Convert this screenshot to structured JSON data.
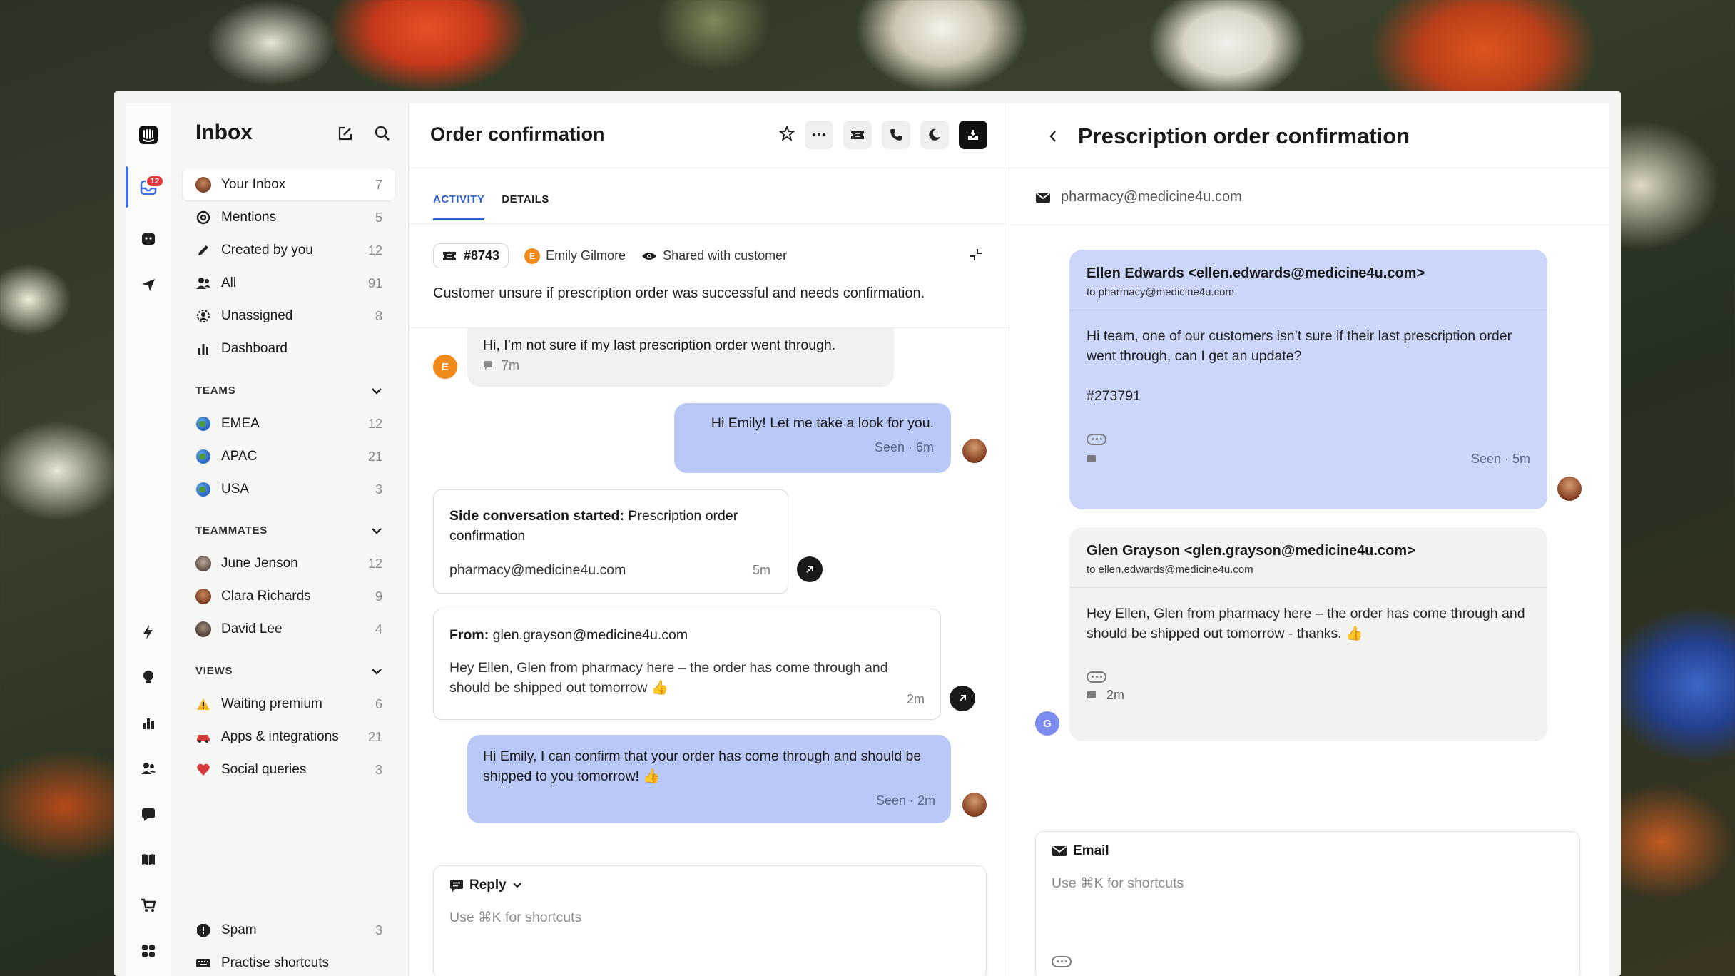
{
  "rail": {
    "badge_count": "12"
  },
  "sidebar": {
    "title": "Inbox",
    "items": [
      {
        "label": "Your Inbox",
        "count": "7"
      },
      {
        "label": "Mentions",
        "count": "5"
      },
      {
        "label": "Created by you",
        "count": "12"
      },
      {
        "label": "All",
        "count": "91"
      },
      {
        "label": "Unassigned",
        "count": "8"
      },
      {
        "label": "Dashboard",
        "count": ""
      }
    ],
    "teams_label": "TEAMS",
    "teams": [
      {
        "label": "EMEA",
        "count": "12"
      },
      {
        "label": "APAC",
        "count": "21"
      },
      {
        "label": "USA",
        "count": "3"
      }
    ],
    "teammates_label": "TEAMMATES",
    "teammates": [
      {
        "label": "June Jenson",
        "count": "12"
      },
      {
        "label": "Clara Richards",
        "count": "9"
      },
      {
        "label": "David Lee",
        "count": "4"
      }
    ],
    "views_label": "VIEWS",
    "views": [
      {
        "label": "Waiting premium",
        "count": "6"
      },
      {
        "label": "Apps & integrations",
        "count": "21"
      },
      {
        "label": "Social queries",
        "count": "3"
      }
    ],
    "bottom": [
      {
        "label": "Spam",
        "count": "3"
      },
      {
        "label": "Practise shortcuts",
        "count": ""
      }
    ]
  },
  "conversation": {
    "title": "Order confirmation",
    "tabs": [
      "ACTIVITY",
      "DETAILS"
    ],
    "ticket_id": "#8743",
    "customer_initial": "E",
    "customer": "Emily Gilmore",
    "shared": "Shared with customer",
    "summary": "Customer unsure if prescription order was successful and needs confirmation.",
    "msg1": {
      "text": "Hi, I’m not sure if my last prescription order went through.",
      "time": "7m",
      "initial": "E"
    },
    "msg2": {
      "text": "Hi Emily! Let me take a look for you.",
      "time": "Seen · 6m"
    },
    "side": {
      "bold": "Side conversation started:",
      "text": " Prescription order confirmation",
      "email": "pharmacy@medicine4u.com",
      "time": "5m"
    },
    "from_card": {
      "bold": "From:",
      "email": " glen.grayson@medicine4u.com",
      "text": "Hey Ellen, Glen from pharmacy here – the order has come through and should be shipped out tomorrow 👍",
      "time": "2m"
    },
    "msg3": {
      "text": "Hi Emily, I can confirm that your order has come through and should be shipped to you tomorrow! 👍",
      "time": "Seen · 2m"
    },
    "composer": {
      "mode": "Reply",
      "placeholder": "Use ⌘K for shortcuts"
    }
  },
  "side_panel": {
    "title": "Prescription order confirmation",
    "address": "pharmacy@medicine4u.com",
    "mail1": {
      "from": "Ellen Edwards <ellen.edwards@medicine4u.com>",
      "to": "to pharmacy@medicine4u.com",
      "body": "Hi team, one of our customers isn’t sure if their last prescription order went through, can I get an update?",
      "ref": "#273791",
      "time": "Seen · 5m"
    },
    "mail2": {
      "from": "Glen Grayson <glen.grayson@medicine4u.com>",
      "to": "to ellen.edwards@medicine4u.com",
      "body": "Hey Ellen, Glen from pharmacy here – the order has come through and should be shipped out tomorrow - thanks. 👍",
      "time": "2m",
      "initial": "G"
    },
    "composer": {
      "mode": "Email",
      "placeholder": "Use ⌘K for shortcuts"
    }
  },
  "colors": {
    "accent": "#2f5fd6",
    "outgoing_bubble": "#b9c8f7",
    "mail_bubble": "#ccd5fa"
  }
}
